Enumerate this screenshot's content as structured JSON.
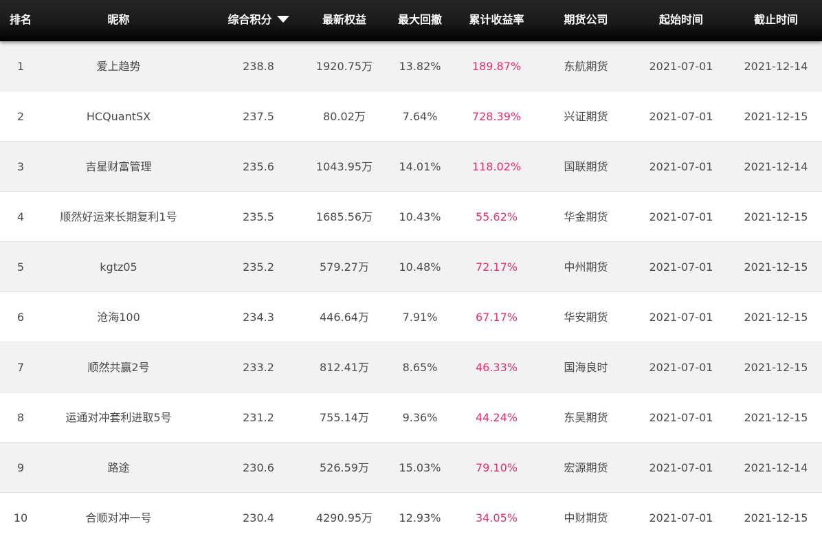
{
  "columns": {
    "rank": "排名",
    "nickname": "昵称",
    "score": "综合积分",
    "equity": "最新权益",
    "drawdown": "最大回撤",
    "return_rate": "累计收益率",
    "company": "期货公司",
    "start": "起始时间",
    "end": "截止时间"
  },
  "sort": {
    "column": "score",
    "direction": "descending",
    "icon": "sort-desc-triangle-icon"
  },
  "colors": {
    "header_bg": "#111111",
    "return_rate": "#e8306a",
    "stripe": "#f2f2f2"
  },
  "rows": [
    {
      "rank": "1",
      "nickname": "爱上趋势",
      "score": "238.8",
      "equity": "1920.75万",
      "drawdown": "13.82%",
      "return_rate": "189.87%",
      "company": "东航期货",
      "start": "2021-07-01",
      "end": "2021-12-14"
    },
    {
      "rank": "2",
      "nickname": "HCQuantSX",
      "score": "237.5",
      "equity": "80.02万",
      "drawdown": "7.64%",
      "return_rate": "728.39%",
      "company": "兴证期货",
      "start": "2021-07-01",
      "end": "2021-12-15"
    },
    {
      "rank": "3",
      "nickname": "吉星财富管理",
      "score": "235.6",
      "equity": "1043.95万",
      "drawdown": "14.01%",
      "return_rate": "118.02%",
      "company": "国联期货",
      "start": "2021-07-01",
      "end": "2021-12-14"
    },
    {
      "rank": "4",
      "nickname": "顺然好运来长期复利1号",
      "score": "235.5",
      "equity": "1685.56万",
      "drawdown": "10.43%",
      "return_rate": "55.62%",
      "company": "华金期货",
      "start": "2021-07-01",
      "end": "2021-12-15"
    },
    {
      "rank": "5",
      "nickname": "kgtz05",
      "score": "235.2",
      "equity": "579.27万",
      "drawdown": "10.48%",
      "return_rate": "72.17%",
      "company": "中州期货",
      "start": "2021-07-01",
      "end": "2021-12-15"
    },
    {
      "rank": "6",
      "nickname": "沧海100",
      "score": "234.3",
      "equity": "446.64万",
      "drawdown": "7.91%",
      "return_rate": "67.17%",
      "company": "华安期货",
      "start": "2021-07-01",
      "end": "2021-12-15"
    },
    {
      "rank": "7",
      "nickname": "顺然共赢2号",
      "score": "233.2",
      "equity": "812.41万",
      "drawdown": "8.65%",
      "return_rate": "46.33%",
      "company": "国海良时",
      "start": "2021-07-01",
      "end": "2021-12-15"
    },
    {
      "rank": "8",
      "nickname": "运通对冲套利进取5号",
      "score": "231.2",
      "equity": "755.14万",
      "drawdown": "9.36%",
      "return_rate": "44.24%",
      "company": "东吴期货",
      "start": "2021-07-01",
      "end": "2021-12-15"
    },
    {
      "rank": "9",
      "nickname": "路途",
      "score": "230.6",
      "equity": "526.59万",
      "drawdown": "15.03%",
      "return_rate": "79.10%",
      "company": "宏源期货",
      "start": "2021-07-01",
      "end": "2021-12-14"
    },
    {
      "rank": "10",
      "nickname": "合顺对冲一号",
      "score": "230.4",
      "equity": "4290.95万",
      "drawdown": "12.93%",
      "return_rate": "34.05%",
      "company": "中财期货",
      "start": "2021-07-01",
      "end": "2021-12-15"
    }
  ]
}
